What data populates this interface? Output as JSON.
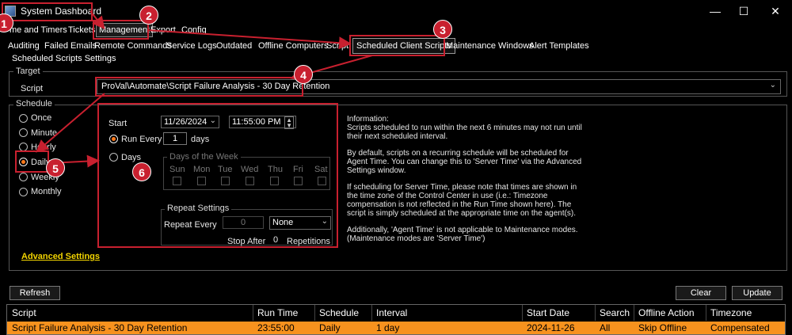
{
  "window": {
    "title": "System Dashboard",
    "minimize": "—",
    "maximize": "☐",
    "close": "✕"
  },
  "menu": [
    {
      "label": "me and Timers"
    },
    {
      "label": "Tickets"
    },
    {
      "label": "Management"
    },
    {
      "label": "Export"
    },
    {
      "label": "Config"
    }
  ],
  "tabs": [
    {
      "label": "Auditing"
    },
    {
      "label": "Failed Emails"
    },
    {
      "label": "Remote Commands"
    },
    {
      "label": "Service Logs"
    },
    {
      "label": "Outdated"
    },
    {
      "label": "Offline Computers"
    },
    {
      "label": "Scripts"
    },
    {
      "label": "Scheduled Client Scripts"
    },
    {
      "label": "Maintenance Windows"
    },
    {
      "label": "Alert Templates"
    }
  ],
  "section_title": "Scheduled Scripts Settings",
  "target": {
    "group_label": "Target",
    "script_label": "Script",
    "script_value": "ProVal\\Automate\\Script Failure Analysis - 30 Day Retention"
  },
  "schedule": {
    "group_label": "Schedule",
    "options": [
      "Once",
      "Minute",
      "Hourly",
      "Daily",
      "Weekly",
      "Monthly"
    ],
    "selected": "Daily"
  },
  "daily": {
    "start_label": "Start",
    "start_date": "11/26/2024",
    "start_time": "11:55:00 PM",
    "run_every_label": "Run Every",
    "run_every_value": "1",
    "run_every_unit": "days",
    "days_label": "Days",
    "dow_group_label": "Days of the Week",
    "dow": [
      "Sun",
      "Mon",
      "Tue",
      "Wed",
      "Thu",
      "Fri",
      "Sat"
    ],
    "repeat_group_label": "Repeat Settings",
    "repeat_every_label": "Repeat Every",
    "repeat_every_value": "0",
    "repeat_unit": "None",
    "stop_after_label": "Stop After",
    "stop_after_value": "0",
    "repetitions_label": "Repetitions"
  },
  "info": {
    "lines": [
      "Information:",
      "Scripts scheduled to run within the next 6 minutes may not run until",
      "their next scheduled interval.",
      "",
      "By default, scripts on a recurring schedule will be scheduled for",
      "Agent Time. You can change this to 'Server Time' via the Advanced",
      "Settings window.",
      "",
      "If scheduling for Server Time, please note that times are shown in",
      "the time zone of the Control Center in use (i.e.: Timezone",
      "compensation is not reflected in the Run Time shown here). The",
      "script is simply scheduled at the appropriate time on the agent(s).",
      "",
      "Additionally, 'Agent Time' is not applicable to Maintenance modes.",
      "(Maintenance modes are 'Server Time')"
    ]
  },
  "advanced_settings_link": "Advanced Settings",
  "buttons": {
    "refresh": "Refresh",
    "clear": "Clear",
    "update": "Update"
  },
  "grid": {
    "columns": [
      "Script",
      "Run Time",
      "Schedule",
      "Interval",
      "Start Date",
      "Search",
      "Offline Action",
      "Timezone"
    ],
    "rows": [
      [
        "Script Failure Analysis - 30 Day Retention",
        "23:55:00",
        "Daily",
        "1 day",
        "2024-11-26",
        "All",
        "Skip Offline",
        "Compensated"
      ]
    ]
  },
  "annotations": [
    "1",
    "2",
    "3",
    "4",
    "5",
    "6"
  ],
  "colors": {
    "highlight": "#c8202f",
    "selected_row": "#f7921e",
    "link": "#f2d400",
    "radio_dot": "#ff7a1a"
  }
}
